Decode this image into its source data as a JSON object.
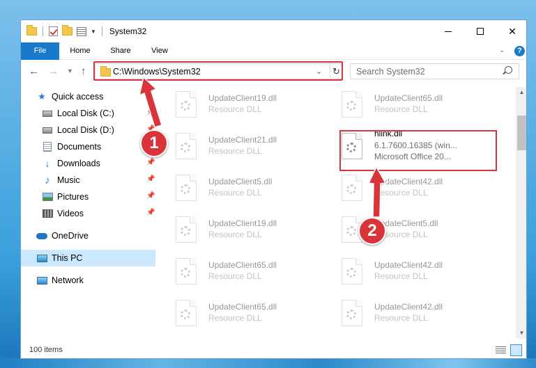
{
  "window": {
    "title": "System32",
    "colors": {
      "accent": "#1979ca",
      "highlight": "#d9343a",
      "selected": "#cce8ff"
    }
  },
  "ribbon": {
    "tabs": [
      {
        "label": "File"
      },
      {
        "label": "Home"
      },
      {
        "label": "Share"
      },
      {
        "label": "View"
      }
    ],
    "help_label": "?"
  },
  "address": {
    "path": "C:\\Windows\\System32",
    "search_placeholder": "Search System32"
  },
  "sidebar": {
    "items": [
      {
        "label": "Quick access",
        "icon": "star-icon"
      },
      {
        "label": "Local Disk (C:)",
        "icon": "drive-icon",
        "pinned": true
      },
      {
        "label": "Local Disk (D:)",
        "icon": "drive-icon",
        "pinned": true
      },
      {
        "label": "Documents",
        "icon": "documents-icon",
        "pinned": true
      },
      {
        "label": "Downloads",
        "icon": "download-icon",
        "pinned": true
      },
      {
        "label": "Music",
        "icon": "music-icon",
        "pinned": true
      },
      {
        "label": "Pictures",
        "icon": "pictures-icon",
        "pinned": true
      },
      {
        "label": "Videos",
        "icon": "videos-icon",
        "pinned": true
      },
      {
        "label": "OneDrive",
        "icon": "onedrive-icon"
      },
      {
        "label": "This PC",
        "icon": "this-pc-icon",
        "selected": true
      },
      {
        "label": "Network",
        "icon": "network-icon"
      }
    ]
  },
  "files": {
    "left_column": [
      {
        "name": "UpdateClient19.dll",
        "type": "Resource DLL"
      },
      {
        "name": "UpdateClient21.dll",
        "type": "Resource DLL"
      },
      {
        "name": "UpdateClient5.dll",
        "type": "Resource DLL"
      },
      {
        "name": "UpdateClient19.dll",
        "type": "Resource DLL"
      },
      {
        "name": "UpdateClient65.dll",
        "type": "Resource DLL"
      },
      {
        "name": "UpdateClient65.dll",
        "type": "Resource DLL"
      }
    ],
    "right_column": [
      {
        "name": "UpdateClient65.dll",
        "type": "Resource DLL"
      },
      {
        "name": "hlink.dll",
        "version": "6.1.7600.16385 (win...",
        "company": "Microsoft Office 20..."
      },
      {
        "name": "UpdateClient42.dll",
        "type": "Resource DLL"
      },
      {
        "name": "UpdateClient5.dll",
        "type": "Resource DLL"
      },
      {
        "name": "UpdateClient42.dll",
        "type": "Resource DLL"
      },
      {
        "name": "UpdateClient42.dll",
        "type": "Resource DLL"
      }
    ]
  },
  "status": {
    "item_count": "100 items"
  },
  "callouts": [
    {
      "number": "1"
    },
    {
      "number": "2"
    }
  ]
}
